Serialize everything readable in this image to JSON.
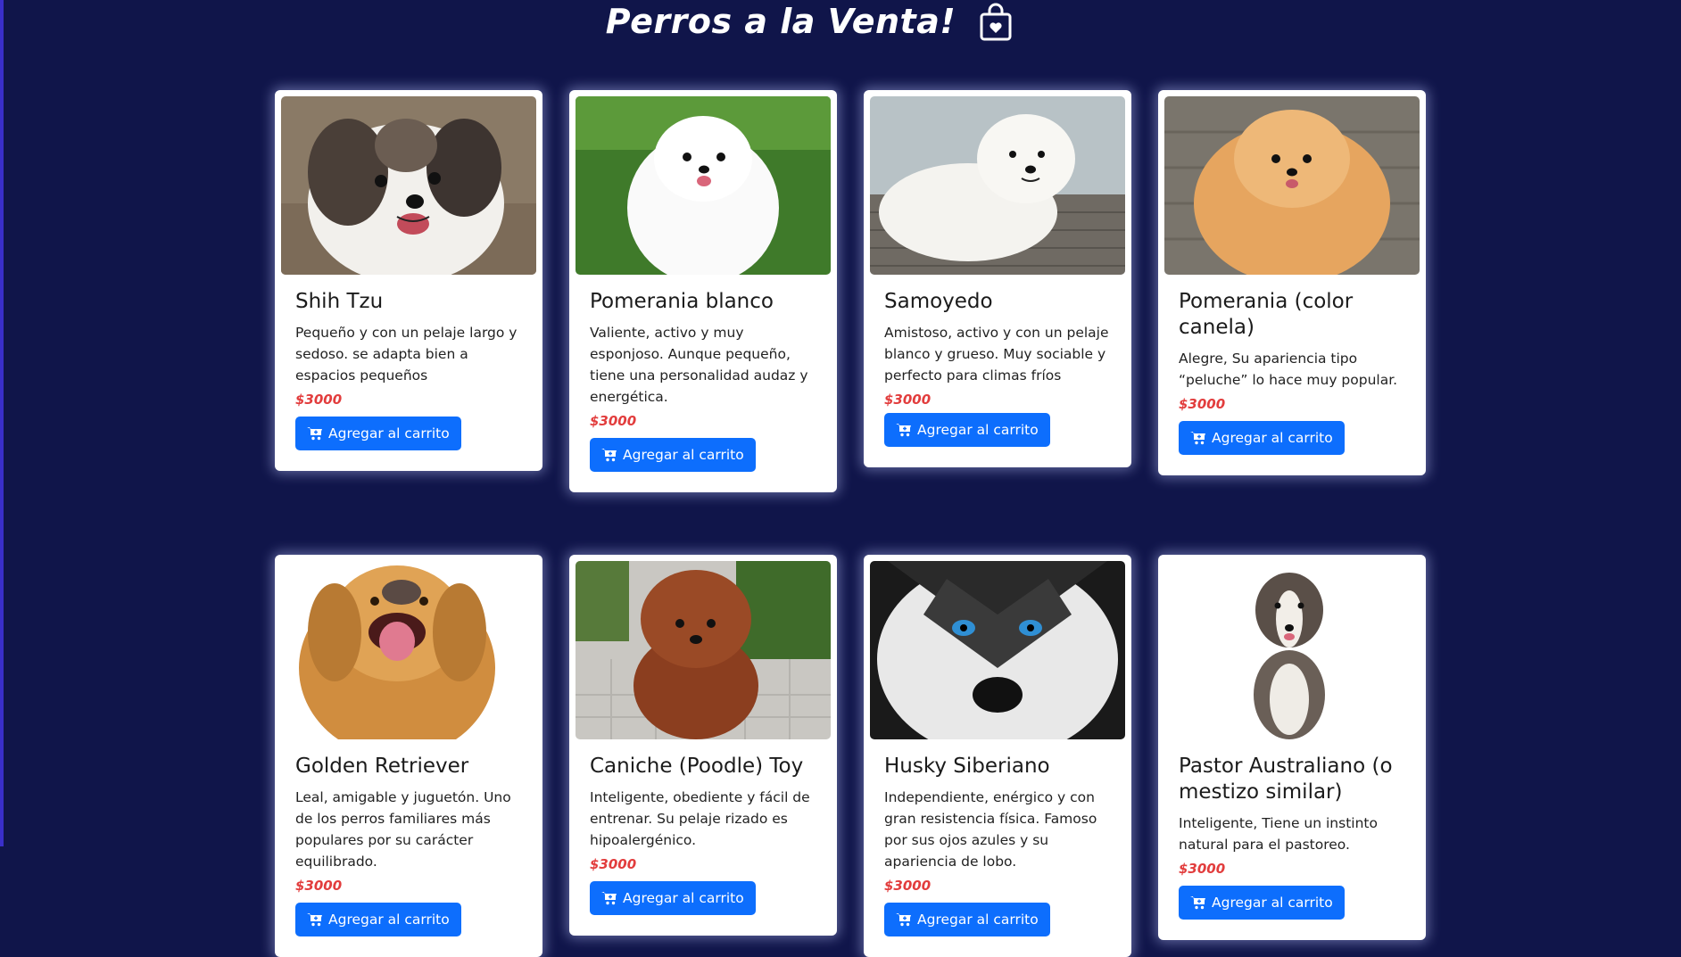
{
  "header": {
    "title": "Perros a la Venta!",
    "icon": "shopping-bag-heart-icon"
  },
  "accent_color": "#0d6efd",
  "price_color": "#e23d3d",
  "background_color": "#10154a",
  "products": [
    {
      "name": "Shih Tzu",
      "description": "Pequeño y con un pelaje largo y sedoso. se adapta bien a espacios pequeños",
      "price": "$3000",
      "button_label": "Agregar al carrito"
    },
    {
      "name": "Pomerania blanco",
      "description": "Valiente, activo y muy esponjoso. Aunque pequeño, tiene una personalidad audaz y energética.",
      "price": "$3000",
      "button_label": "Agregar al carrito"
    },
    {
      "name": "Samoyedo",
      "description": "Amistoso, activo y con un pelaje blanco y grueso. Muy sociable y perfecto para climas fríos",
      "price": "$3000",
      "button_label": "Agregar al carrito"
    },
    {
      "name": "Pomerania (color canela)",
      "description": "Alegre, Su apariencia tipo “peluche” lo hace muy popular.",
      "price": "$3000",
      "button_label": "Agregar al carrito"
    },
    {
      "name": "Golden Retriever",
      "description": "Leal, amigable y juguetón. Uno de los perros familiares más populares por su carácter equilibrado.",
      "price": "$3000",
      "button_label": "Agregar al carrito"
    },
    {
      "name": "Caniche (Poodle) Toy",
      "description": "Inteligente, obediente y fácil de entrenar. Su pelaje rizado es hipoalergénico.",
      "price": "$3000",
      "button_label": "Agregar al carrito"
    },
    {
      "name": "Husky Siberiano",
      "description": "Independiente, enérgico y con gran resistencia física. Famoso por sus ojos azules y su apariencia de lobo.",
      "price": "$3000",
      "button_label": "Agregar al carrito"
    },
    {
      "name": "Pastor Australiano (o mestizo similar)",
      "description": "Inteligente, Tiene un instinto natural para el pastoreo.",
      "price": "$3000",
      "button_label": "Agregar al carrito"
    }
  ]
}
